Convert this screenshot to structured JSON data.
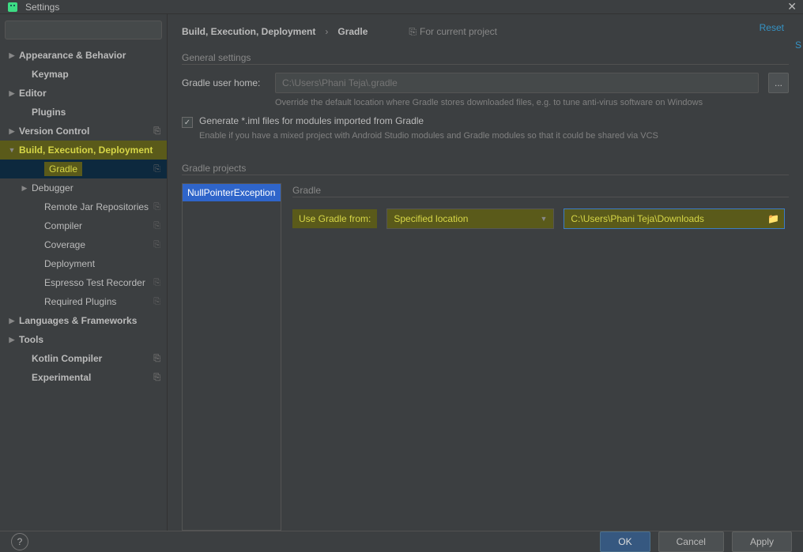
{
  "window": {
    "title": "Settings"
  },
  "search": {
    "placeholder": ""
  },
  "tree": {
    "items": [
      {
        "label": "Appearance & Behavior",
        "lvl": 0,
        "arrow": "▶",
        "bold": true
      },
      {
        "label": "Keymap",
        "lvl": 1,
        "bold": true
      },
      {
        "label": "Editor",
        "lvl": 0,
        "arrow": "▶",
        "bold": true
      },
      {
        "label": "Plugins",
        "lvl": 1,
        "bold": true
      },
      {
        "label": "Version Control",
        "lvl": 0,
        "arrow": "▶",
        "bold": true,
        "copy": true
      },
      {
        "label": "Build, Execution, Deployment",
        "lvl": 0,
        "arrow": "▼",
        "bold": true,
        "hlYellow": true
      },
      {
        "label": "Gradle",
        "lvl": 2,
        "copy": true,
        "gradle": true
      },
      {
        "label": "Debugger",
        "lvl": 1,
        "arrow": "▶"
      },
      {
        "label": "Remote Jar Repositories",
        "lvl": 2,
        "copy": true
      },
      {
        "label": "Compiler",
        "lvl": 2,
        "copy": true
      },
      {
        "label": "Coverage",
        "lvl": 2,
        "copy": true
      },
      {
        "label": "Deployment",
        "lvl": 2
      },
      {
        "label": "Espresso Test Recorder",
        "lvl": 2,
        "copy": true
      },
      {
        "label": "Required Plugins",
        "lvl": 2,
        "copy": true
      },
      {
        "label": "Languages & Frameworks",
        "lvl": 0,
        "arrow": "▶",
        "bold": true
      },
      {
        "label": "Tools",
        "lvl": 0,
        "arrow": "▶",
        "bold": true
      },
      {
        "label": "Kotlin Compiler",
        "lvl": 1,
        "bold": true,
        "copy": true
      },
      {
        "label": "Experimental",
        "lvl": 1,
        "bold": true,
        "copy": true
      }
    ]
  },
  "breadcrumb": {
    "root": "Build, Execution, Deployment",
    "leaf": "Gradle",
    "scope": "For current project",
    "reset": "Reset"
  },
  "general": {
    "section": "General settings",
    "userhome_label": "Gradle user home:",
    "userhome_placeholder": "C:\\Users\\Phani Teja\\.gradle",
    "userhome_hint": "Override the default location where Gradle stores downloaded files, e.g. to tune anti-virus software on Windows",
    "browse": "...",
    "gen_label": "Generate *.iml files for modules imported from Gradle",
    "gen_hint": "Enable if you have a mixed project with Android Studio modules and Gradle modules so that it could be shared via VCS"
  },
  "projects": {
    "section": "Gradle projects",
    "item": "NullPointerException",
    "detail_section": "Gradle",
    "use_from_label": "Use Gradle from:",
    "use_from_value": "Specified location",
    "path_value": "C:\\Users\\Phani Teja\\Downloads"
  },
  "footer": {
    "ok": "OK",
    "cancel": "Cancel",
    "apply": "Apply",
    "help": "?"
  }
}
